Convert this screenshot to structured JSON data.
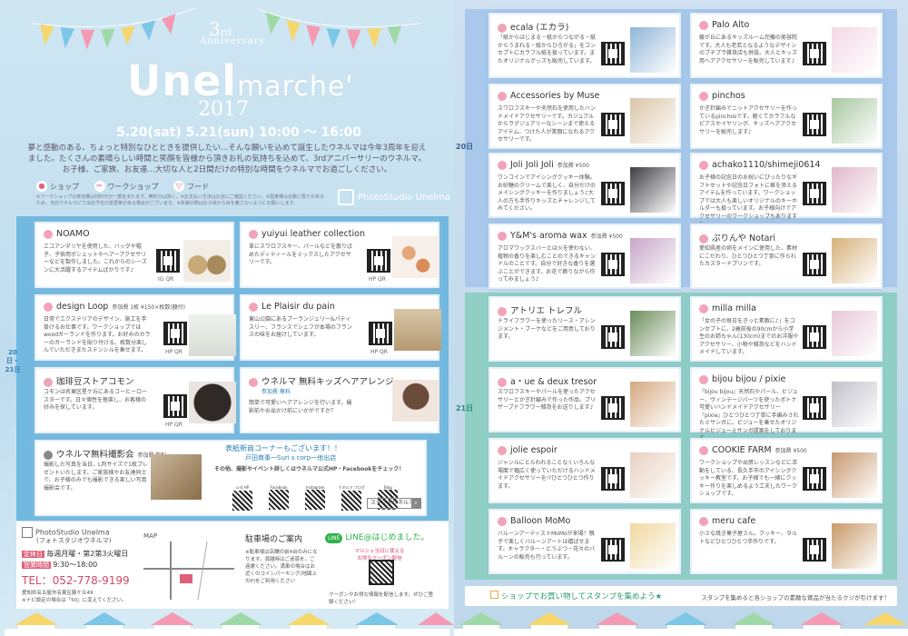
{
  "left": {
    "anniv_number": "3",
    "anniv_suffix": "rd",
    "anniversary": "Anniversary",
    "logo_main": "Unel",
    "logo_sub": "marche'",
    "year": "2017",
    "dates": "5.20(sat) 5.21(sun) 10:00 〜 16:00",
    "intro": "夢と感動のある、ちょっと特別なひとときを提供したい…そんな願いを込めて誕生したウネルマは今年3周年を迎えました。たくさんの素晴らしい時間と笑顔を皆様から頂きお礼の気持ちを込めて、3rdアニバーサリーのウネルマ。お子様、ご家族、お友達…大切な人と2日間だけの特別な時間をウネルマでお過ごしください。",
    "legend": [
      "ショップ",
      "ワークショップ",
      "フード"
    ],
    "note": "※ワークショップの参加費は材料代が一部含まれます。無料分は除く。※お支払い方法はお店にご確認ください。※駐車場は台数に限りがあるため、当日ウネルマにて出店予定の変更等がある場合がございます。※体験の際はお子様から目を離さないようにお願いします。",
    "studio_logo": "PhotoStudio Unelma",
    "day_label": "20日・21日",
    "cards": [
      {
        "name": "NOAMO",
        "desc": "エコアンダリヤを使用した、バッグや帽子、子供用ポシェットやヘアーアクセサリーなどを製作しました。これからのシーズンに大活躍するアイテムばかりです♪",
        "qr": "IG QR"
      },
      {
        "name": "yuiyui leather collection",
        "desc": "革にスワロフスキー、パールなどを散りばめたディティールをミックスしたアクセサリーです。",
        "qr": "HP QR"
      },
      {
        "name": "design Loop",
        "tag": "参加費 1枚 ¥150×枚数(額付)",
        "desc": "日常でエクステリアのデザイン、施工を手掛けるお仕事です。ワークショップでは woodガーランドを作ります。お好みのカラーのガーランドを貼り付ける。枚数分楽しんでいただきまたステンシルを乗せます。",
        "qr": "HP QR"
      },
      {
        "name": "Le Plaisir du pain",
        "desc": "東山公園にあるブーランジェリー&パティスリー、フランスでシェフが本場のフランスの味をお届けしています。",
        "qr": "HP QR"
      },
      {
        "name": "珈琲豆ストアコモン",
        "desc": "コモンは名東区星ケ丘にあるコーヒーロースターです。日々個性を極楽し、お客様の好みを探しています。",
        "qr": "HP QR"
      },
      {
        "name": "ウネルマ 無料キッズヘアアレンジ",
        "tag": "参加費 無料",
        "desc": "簡単で可愛いヘアアレンジを行います。撮影前やお出かけ前にいかがですか？",
        "qr": ""
      },
      {
        "name": "ウネルマ無料撮影会",
        "tag": "参加費 無料",
        "desc": "撮影した写真を当日、L判サイズで1枚プレゼントいたします。ご家族様やお友達同士で、お子様のみでも撮影できる楽しい写真撮影会です。",
        "qr": ""
      }
    ],
    "info_title": "表紙新商コーナーもございます！！",
    "info_sub": "戸田商事一Suri s corp一他出店",
    "sns_note": "その他、撮影やイベント詳しくはウネルマ公式HP・Facebookをチェック！",
    "sns": [
      "公式 HP",
      "Facebook",
      "Instagram",
      "ウネルマ ブログ",
      "Blog"
    ],
    "search_placeholder": "スタジオウネルマ",
    "footer_studio": "PhotoStudio Unelma",
    "footer_studio_jp": "(フォトスタジオウネルマ)",
    "holiday_label": "定休日",
    "holiday": "毎週月曜・第2第3火曜日",
    "hours_label": "営業時間",
    "hours": "9:30〜18:00",
    "tel": "TEL：052-778-9199",
    "address": "愛知県名古屋市名東区藤ケ丘49",
    "address_note": "※ナビ設定の場合は「50」に変えてください。",
    "map_label": "MAP",
    "parking_title": "駐車場のご案内",
    "parking": "※駐車場は店舗の前4台のみになります。混雑時はご迷惑を。ご遠慮ください。満車の場合はお近くのコインパーキング(地図上のP)をご利用ください",
    "line_title": "LINE@はじめました。",
    "line_note": "マルシェ当日に使える お得なクーポン配信中！",
    "coupon_note": "クーポンやお得な情報を配信します。ぜひご登録ください！"
  },
  "right": {
    "day1": "20日",
    "day2": "21日",
    "cards": [
      {
        "name": "ecala (エカラ)",
        "desc": "「紙からはじまる・紙からつながる・紙からうまれる・紙からひろがる」をコンセプトにカラフル紙を扱っています。またオリジナルグッズも販売しています。"
      },
      {
        "name": "Palo Alto",
        "desc": "藤が丘にあるキッズルーム完備の美容院です。大人も老若となるようなデザインのプチプラ雑貨店も併設。大人とキッズ用ヘアアクセサリーを販売しています♪"
      },
      {
        "name": "Accessories by Muse",
        "desc": "スワロフスキーや天然石を使用したハンドメイドアクセサリーです。カジュアルからラグジュアリーなシーンまで使えるアイテム。つけた人が笑顔になれるアクセサリーです。"
      },
      {
        "name": "pinchos",
        "desc": "かぎ針編みでニットアクセサリーを作っているpinchosです。軽くてカラフルなピアスやイヤリング、キッズヘアアクセサリーを販売します♪"
      },
      {
        "name": "Joli Joli Joli",
        "tag": "参加費 ¥500",
        "desc": "ワンコインでアイシングクッキー体験。お砂糖のクリームで楽しく、自分だけのメイシングクッキーを作りましょう♪大人の方も手作りキッズとチャレンジしてみてください。"
      },
      {
        "name": "achako1110/shimeji0614",
        "desc": "お子様の記念日のお祝いにぴったりなギフトセットや記念日フォトに華を添えるアイテムを作っています。ワークショップでは大人も楽しいオリジナルのキーホルダーも扱っています。お子様向けでアクセサリーのワークショップもあります♪"
      },
      {
        "name": "Y&M's aroma wax",
        "tag": "参加費 ¥500",
        "desc": "アロマワックスバーとは火を使わない、植物の香りを楽しむことのできるキャンドルのことです。自分で好きな香りを選ぶことができます。お花で飾りながら作ってみましょう♪"
      },
      {
        "name": "ぷりんや Notari",
        "desc": "愛知県産の卵をメインに使用した、素材にこだわり、ひとつひとつ丁寧に作られたカスタードプリンです。"
      },
      {
        "name": "アトリエ トレフル",
        "desc": "ドライフラワーを使ったリース・アレンジメント・ブーケなどをご用意しております。"
      },
      {
        "name": "milla milla",
        "desc": "「女の子の毎日をきっと素敵に♪」をコンセプトに、2歳前後の90cmから小学生のお姉ちゃん(130cm)までのお洋服やアクセサリー、小物や雑貨などをハンドメイドしています。"
      },
      {
        "name": "a・ue & deux tresor",
        "desc": "スワロフスキーやパールを使ったアクセサリーとかぎ針編みで作った作品、プリザーブドフラワー雑貨をお送りします♪"
      },
      {
        "name": "bijou bijou / pixie",
        "desc": "『bijou bijou』天然石やパール、ビジュー、ヴィンテージパーツを使ったボトナ可愛いハンドメイドアクセサリー『pixie』ひとつひとつ丁寧に手編みされたミサンガに、ビジューを乗せたオリジナルビジューミサンガ提案をしております。"
      },
      {
        "name": "jolie espoir",
        "desc": "ジャンルにとらわれることなくいろんな場面で幅広く使っていただけるハンドメイドアクセサリーを!?ひとつひとつ作ります。"
      },
      {
        "name": "COOKIE FARM",
        "tag": "参加費 ¥500",
        "desc": "ワークショップや出張レッスンなどに活動をしている、長久手市のアイシングクッキー教室です。お子様でも一緒にクッキー作りを楽しめるよう工夫したワークショップです。"
      },
      {
        "name": "Balloon MoMo",
        "desc": "バルーンアーティストMoMoが来場！親子で楽しくバルーンアートは嬉ばせます。キャラクター・どうぶつ・花々のバルーンの販売も行っています。"
      },
      {
        "name": "meru cafe",
        "desc": "小さな焼き菓子屋さん。クッキー、タルトなどひとつひとつ手作りです。"
      }
    ],
    "stamp_title": "ショップでお買い物してスタンプを集めよう★",
    "stamp_note": "スタンプを集めると各ショップの素敵な賞品が当たるクジが引けます！"
  }
}
